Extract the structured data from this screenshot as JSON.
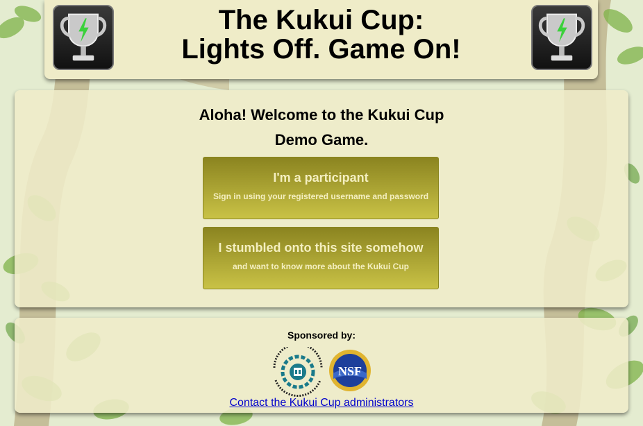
{
  "header": {
    "title_line1": "The Kukui Cup:",
    "title_line2": "Lights Off. Game On!"
  },
  "welcome": {
    "line1": "Aloha! Welcome to the Kukui Cup",
    "line2": "Demo Game."
  },
  "choices": [
    {
      "heading": "I'm a participant",
      "subtext": "Sign in using your registered username and password"
    },
    {
      "heading": "I stumbled onto this site somehow",
      "subtext": "and want to know more about the Kukui Cup"
    }
  ],
  "sponsors": {
    "label": "Sponsored by:",
    "logos": [
      {
        "name": "csdl-logo",
        "text": "collaborative software development laboratory"
      },
      {
        "name": "nsf-logo",
        "text": "NSF"
      }
    ]
  },
  "footer": {
    "contact_link": "Contact the Kukui Cup administrators"
  },
  "colors": {
    "panel": "#efecc8",
    "button_top": "#8b8420",
    "button_bottom": "#c9c246",
    "button_text": "#f4efc0",
    "link": "#0000cc"
  },
  "icons": [
    "trophy-icon",
    "lightning-bolt-icon"
  ]
}
